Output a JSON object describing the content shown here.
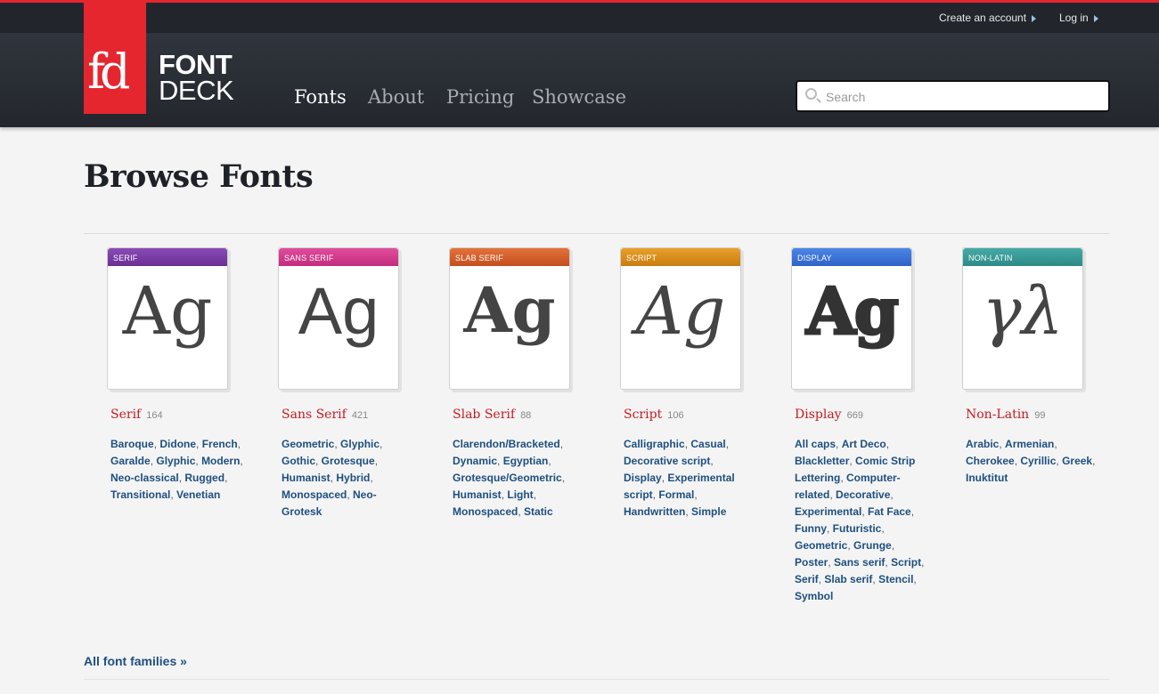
{
  "header": {
    "util_links": [
      "Create an account",
      "Log in"
    ],
    "logo": {
      "mark": "fd",
      "word1": "FONT",
      "word2": "DECK"
    },
    "nav": [
      {
        "label": "Fonts",
        "active": true
      },
      {
        "label": "About",
        "active": false
      },
      {
        "label": "Pricing",
        "active": false
      },
      {
        "label": "Showcase",
        "active": false
      }
    ],
    "search": {
      "placeholder": "Search",
      "value": ""
    }
  },
  "page_title": "Browse Fonts",
  "categories": [
    {
      "tab": "SERIF",
      "glyph": "Ag",
      "name": "Serif",
      "count": "164",
      "color": "#7b3fa6",
      "tags": [
        "Baroque",
        "Didone",
        "French",
        "Garalde",
        "Glyphic",
        "Modern",
        "Neo-classical",
        "Rugged",
        "Transitional",
        "Venetian"
      ]
    },
    {
      "tab": "SANS SERIF",
      "glyph": "Ag",
      "name": "Sans Serif",
      "count": "421",
      "color": "#d63b8e",
      "tags": [
        "Geometric",
        "Glyphic",
        "Gothic",
        "Grotesque",
        "Humanist",
        "Hybrid",
        "Monospaced",
        "Neo-Grotesk"
      ]
    },
    {
      "tab": "SLAB SERIF",
      "glyph": "Ag",
      "name": "Slab Serif",
      "count": "88",
      "color": "#d8612a",
      "tags": [
        "Clarendon/Bracketed",
        "Dynamic",
        "Egyptian",
        "Grotesque/Geometric",
        "Humanist",
        "Light",
        "Monospaced",
        "Static"
      ]
    },
    {
      "tab": "SCRIPT",
      "glyph": "Ag",
      "name": "Script",
      "count": "106",
      "color": "#e08f1c",
      "tags": [
        "Calligraphic",
        "Casual",
        "Decorative script",
        "Display",
        "Experimental script",
        "Formal",
        "Handwritten",
        "Simple"
      ]
    },
    {
      "tab": "DISPLAY",
      "glyph": "Ag",
      "name": "Display",
      "count": "669",
      "color": "#3d75d9",
      "tags": [
        "All caps",
        "Art Deco",
        "Blackletter",
        "Comic Strip Lettering",
        "Computer-related",
        "Decorative",
        "Experimental",
        "Fat Face",
        "Funny",
        "Futuristic",
        "Geometric",
        "Grunge",
        "Poster",
        "Sans serif",
        "Script",
        "Serif",
        "Slab serif",
        "Stencil",
        "Symbol"
      ]
    },
    {
      "tab": "NON-LATIN",
      "glyph": "γλ",
      "name": "Non-Latin",
      "count": "99",
      "color": "#3a9a97",
      "tags": [
        "Arabic",
        "Armenian",
        "Cherokee",
        "Cyrillic",
        "Greek",
        "Inuktitut"
      ]
    }
  ],
  "all_link": "All font families »"
}
